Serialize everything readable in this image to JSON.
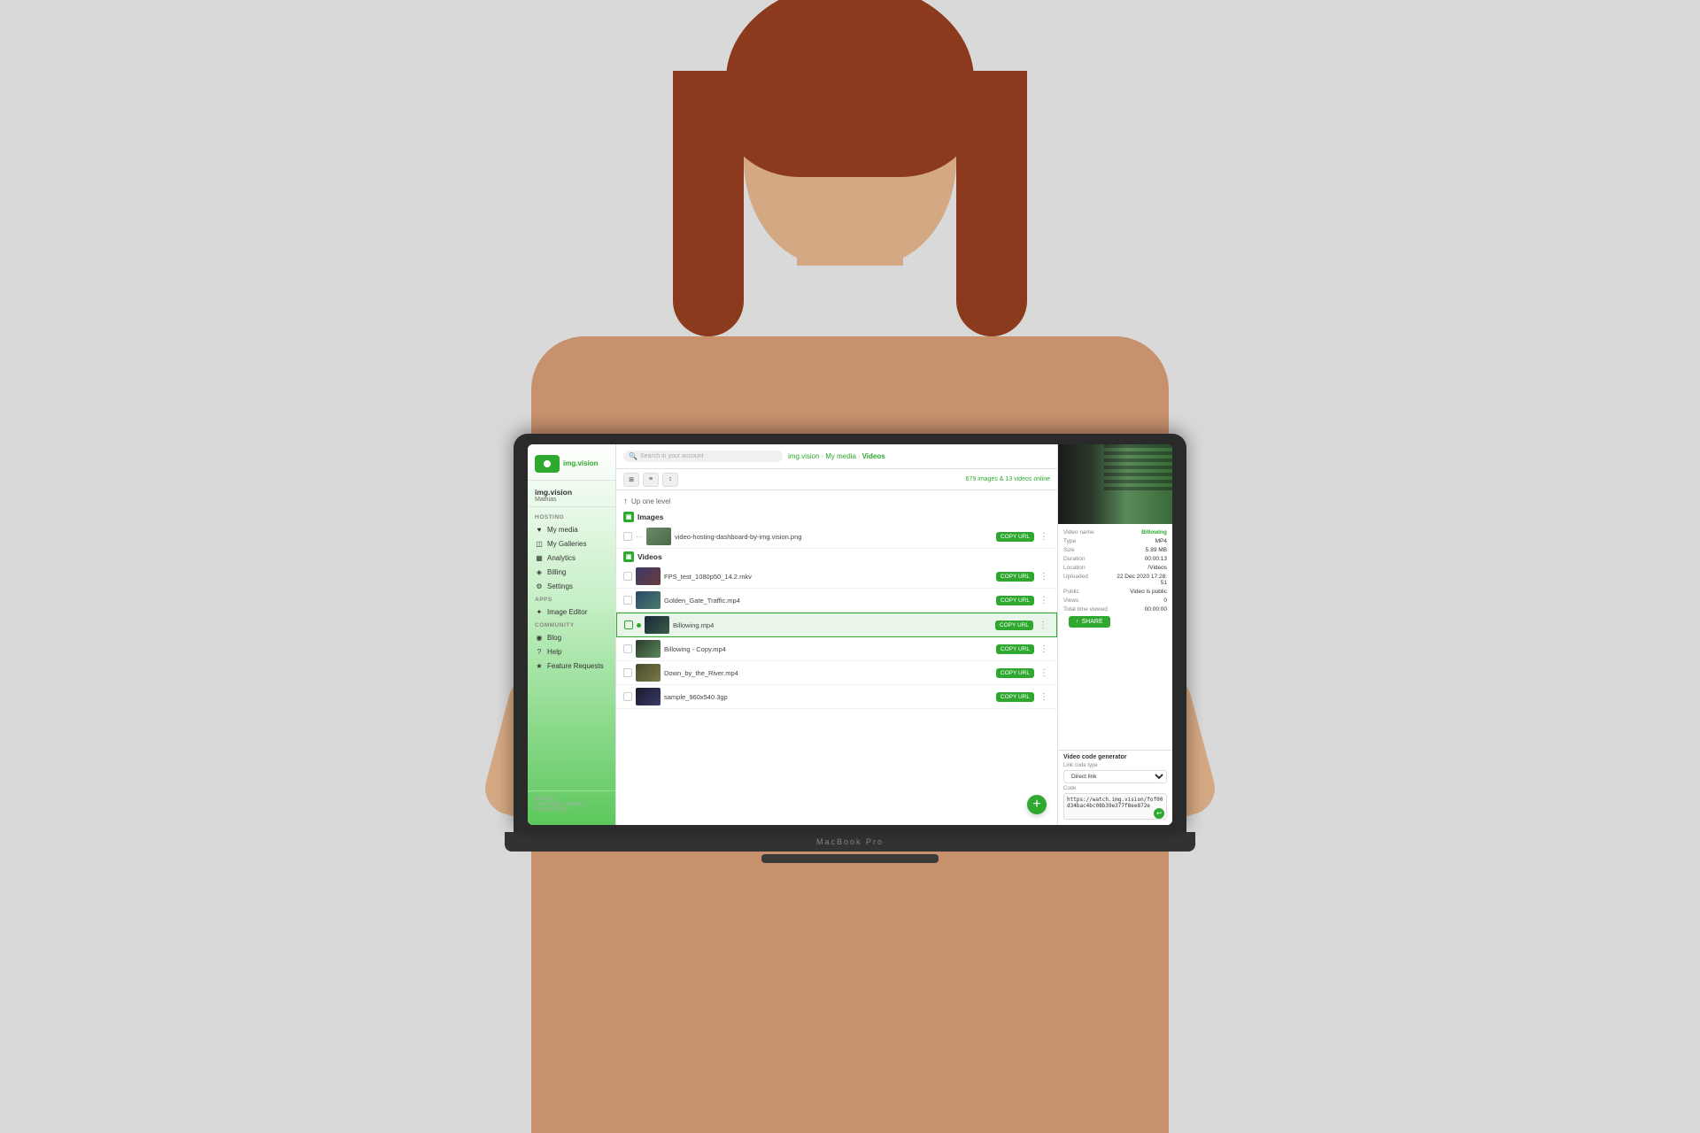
{
  "background": {
    "color": "#d9d9d9"
  },
  "laptop": {
    "brand_label": "MacBook Pro"
  },
  "app": {
    "logo": {
      "text": "img.vision"
    },
    "topbar": {
      "search_placeholder": "Search in your account",
      "breadcrumb": [
        "img.vision",
        "My media",
        "Videos"
      ]
    },
    "toolbar": {
      "count": "679 images & 13 videos online"
    },
    "sidebar": {
      "user_name": "img.vision",
      "user_sub": "Mathias",
      "sections": [
        {
          "title": "HOSTING",
          "items": [
            {
              "label": "My media",
              "icon": "♥"
            },
            {
              "label": "My Galleries",
              "icon": "◫"
            },
            {
              "label": "Analytics",
              "icon": "▦"
            },
            {
              "label": "Billing",
              "icon": "◈"
            },
            {
              "label": "Settings",
              "icon": "⚙"
            }
          ]
        },
        {
          "title": "APPS",
          "items": [
            {
              "label": "Image Editor",
              "icon": "✦"
            }
          ]
        },
        {
          "title": "COMMUNITY",
          "items": [
            {
              "label": "Blog",
              "icon": "◉"
            },
            {
              "label": "Help",
              "icon": "?"
            },
            {
              "label": "Feature Requests",
              "icon": "★"
            }
          ]
        }
      ],
      "footer": {
        "line1": "NOTICE",
        "line2": "Third Party Licenses",
        "line3": "Privacy Policy"
      }
    },
    "file_browser": {
      "up_one_level": "Up one level",
      "sections": [
        {
          "name": "Images",
          "files": [
            {
              "name": "video-hosting-dashboard-by-img.vision.png",
              "type": "image",
              "copy_url": "COPY URL"
            }
          ]
        },
        {
          "name": "Videos",
          "files": [
            {
              "name": "FPS_test_1080p50_14.2.mkv",
              "type": "video",
              "copy_url": "COPY URL"
            },
            {
              "name": "Golden_Gate_Traffic.mp4",
              "type": "video",
              "copy_url": "COPY URL"
            },
            {
              "name": "Billowing.mp4",
              "type": "video",
              "copy_url": "COPY URL",
              "selected": true
            },
            {
              "name": "Billowing - Copy.mp4",
              "type": "video",
              "copy_url": "COPY URL"
            },
            {
              "name": "Down_by_the_River.mp4",
              "type": "video",
              "copy_url": "COPY URL"
            },
            {
              "name": "sample_960x540.3gp",
              "type": "video",
              "copy_url": "COPY URL"
            }
          ]
        }
      ]
    },
    "right_panel": {
      "video_name_label": "Video name",
      "video_name_value": "Billowing",
      "type_label": "Type",
      "type_value": "MP4",
      "size_label": "Size",
      "size_value": "5.89 MB",
      "duration_label": "Duration",
      "duration_value": "00:00:13",
      "location_label": "Location",
      "location_value": "/Videos",
      "uploaded_label": "Uploaded",
      "uploaded_value": "22 Dec 2020 17:28:51",
      "public_label": "Public",
      "public_value": "Video is public",
      "views_label": "Views",
      "views_value": "0",
      "total_time_label": "Total time viewed",
      "total_time_value": "00:00:00",
      "share_button": "SHARE",
      "video_code_section_title": "Video code generator",
      "link_type_label": "Link code type",
      "link_type_value": "Direct link",
      "code_label": "Code",
      "code_value": "https://watch.img.vision/fof00d34bac4bc08b39e377f8ee872e"
    }
  }
}
